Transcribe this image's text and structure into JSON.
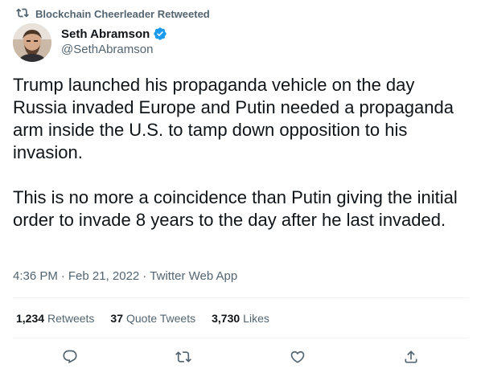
{
  "retweet_context": {
    "label": "Blockchain Cheerleader Retweeted",
    "icon": "retweet-icon"
  },
  "author": {
    "display_name": "Seth Abramson",
    "handle": "@SethAbramson",
    "verified": true,
    "verified_icon": "verified-badge-icon",
    "avatar": "avatar"
  },
  "tweet": {
    "paragraph_1": "Trump launched his propaganda vehicle on the day Russia invaded Europe and Putin needed a propaganda arm inside the U.S. to tamp down opposition to his invasion.",
    "paragraph_2": "This is no more a coincidence than Putin giving the initial order to invade 8 years to the day after he last invaded."
  },
  "meta": {
    "time": "4:36 PM",
    "separator_1": "·",
    "date": "Feb 21, 2022",
    "separator_2": "·",
    "source": "Twitter Web App"
  },
  "stats": {
    "retweets_count": "1,234",
    "retweets_label": "Retweets",
    "quote_tweets_count": "37",
    "quote_tweets_label": "Quote Tweets",
    "likes_count": "3,730",
    "likes_label": "Likes"
  },
  "actions": {
    "reply_icon": "reply-icon",
    "retweet_icon": "retweet-icon",
    "like_icon": "heart-icon",
    "share_icon": "share-icon"
  },
  "colors": {
    "text_primary": "#0f1419",
    "text_secondary": "#536471",
    "verified": "#1d9bf0",
    "divider": "#eff3f4"
  }
}
